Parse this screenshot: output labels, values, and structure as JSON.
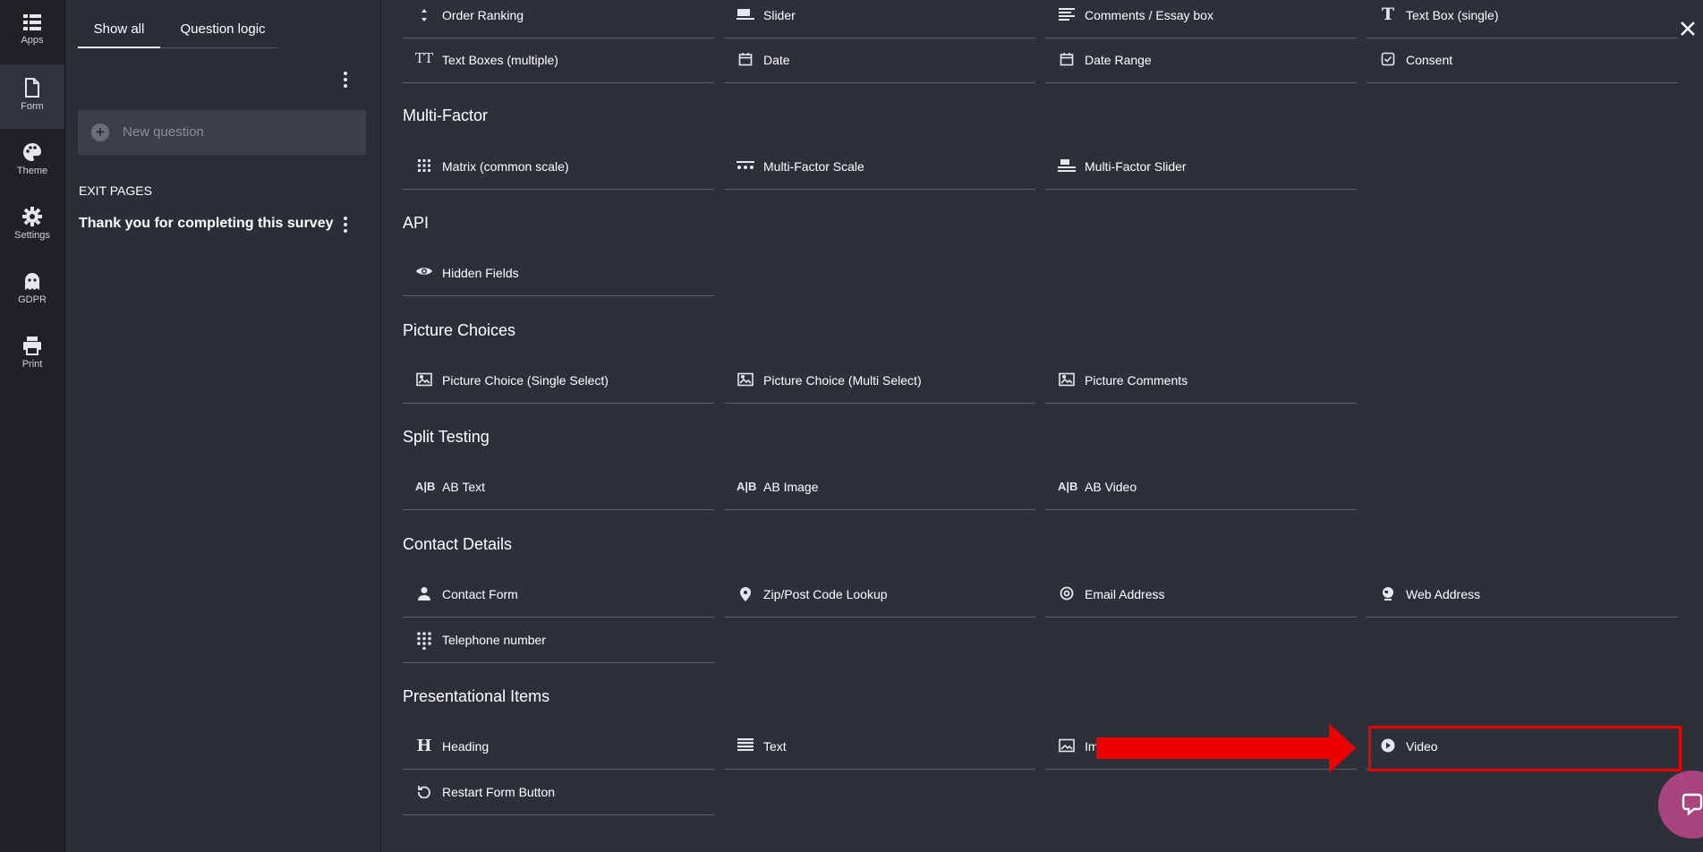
{
  "sidenav": {
    "items": [
      {
        "label": "Apps",
        "icon": "apps-grid-icon"
      },
      {
        "label": "Form",
        "icon": "document-icon"
      },
      {
        "label": "Theme",
        "icon": "palette-icon"
      },
      {
        "label": "Settings",
        "icon": "gear-icon"
      },
      {
        "label": "GDPR",
        "icon": "ghost-icon"
      },
      {
        "label": "Print",
        "icon": "printer-icon"
      }
    ],
    "active": "Form"
  },
  "panel": {
    "tabs": [
      "Show all",
      "Question logic"
    ],
    "active_tab": "Show all",
    "new_question": "New question",
    "exit_heading": "EXIT PAGES",
    "exit_page_title": "Thank you for completing this survey"
  },
  "sections": {
    "top_row1": [
      "Order Ranking",
      "Slider",
      "Comments / Essay box",
      "Text Box (single)"
    ],
    "top_row2": [
      "Text Boxes (multiple)",
      "Date",
      "Date Range",
      "Consent"
    ],
    "multi_factor": {
      "title": "Multi-Factor",
      "items": [
        "Matrix (common scale)",
        "Multi-Factor Scale",
        "Multi-Factor Slider"
      ]
    },
    "api": {
      "title": "API",
      "items": [
        "Hidden Fields"
      ]
    },
    "picture_choices": {
      "title": "Picture Choices",
      "items": [
        "Picture Choice (Single Select)",
        "Picture Choice (Multi Select)",
        "Picture Comments"
      ]
    },
    "split_testing": {
      "title": "Split Testing",
      "items": [
        "AB Text",
        "AB Image",
        "AB Video"
      ]
    },
    "contact_details": {
      "title": "Contact Details",
      "items": [
        "Contact Form",
        "Zip/Post Code Lookup",
        "Email Address",
        "Web Address",
        "Telephone number"
      ]
    },
    "presentational": {
      "title": "Presentational Items",
      "items": [
        "Heading",
        "Text",
        "Im",
        "Video",
        "Restart Form Button"
      ]
    }
  },
  "colors": {
    "background": "#2d3039",
    "sidebar": "#1f2127",
    "highlight": "#ef0000",
    "chat": "#a9447f"
  }
}
